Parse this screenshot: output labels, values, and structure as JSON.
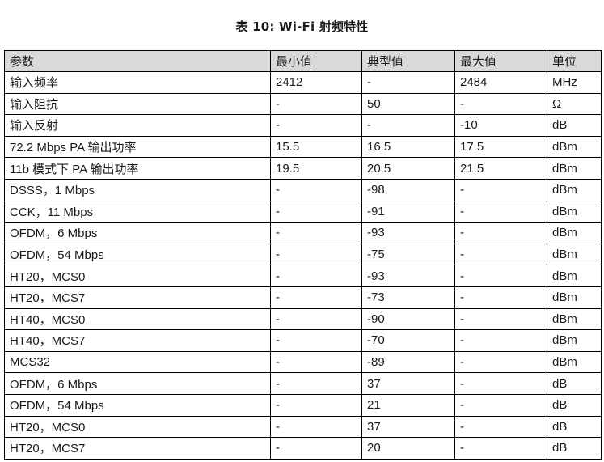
{
  "caption": "表 10: Wi-Fi 射频特性",
  "table": {
    "headers": [
      "参数",
      "最小值",
      "典型值",
      "最大值",
      "单位"
    ],
    "rows": [
      [
        "输入频率",
        "2412",
        "-",
        "2484",
        "MHz"
      ],
      [
        "输入阻抗",
        "-",
        "50",
        "-",
        "Ω"
      ],
      [
        "输入反射",
        "-",
        "-",
        "-10",
        "dB"
      ],
      [
        "72.2 Mbps PA 输出功率",
        "15.5",
        "16.5",
        "17.5",
        "dBm"
      ],
      [
        "11b 模式下 PA 输出功率",
        "19.5",
        "20.5",
        "21.5",
        "dBm"
      ],
      [
        "DSSS，1 Mbps",
        "-",
        "-98",
        "-",
        "dBm"
      ],
      [
        "CCK，11 Mbps",
        "-",
        "-91",
        "-",
        "dBm"
      ],
      [
        "OFDM，6 Mbps",
        "-",
        "-93",
        "-",
        "dBm"
      ],
      [
        "OFDM，54 Mbps",
        "-",
        "-75",
        "-",
        "dBm"
      ],
      [
        "HT20，MCS0",
        "-",
        "-93",
        "-",
        "dBm"
      ],
      [
        "HT20，MCS7",
        "-",
        "-73",
        "-",
        "dBm"
      ],
      [
        "HT40，MCS0",
        "-",
        "-90",
        "-",
        "dBm"
      ],
      [
        "HT40，MCS7",
        "-",
        "-70",
        "-",
        "dBm"
      ],
      [
        "MCS32",
        "-",
        "-89",
        "-",
        "dBm"
      ],
      [
        "OFDM，6 Mbps",
        "-",
        "37",
        "-",
        "dB"
      ],
      [
        "OFDM，54 Mbps",
        "-",
        "21",
        "-",
        "dB"
      ],
      [
        "HT20，MCS0",
        "-",
        "37",
        "-",
        "dB"
      ],
      [
        "HT20，MCS7",
        "-",
        "20",
        "-",
        "dB"
      ]
    ]
  }
}
